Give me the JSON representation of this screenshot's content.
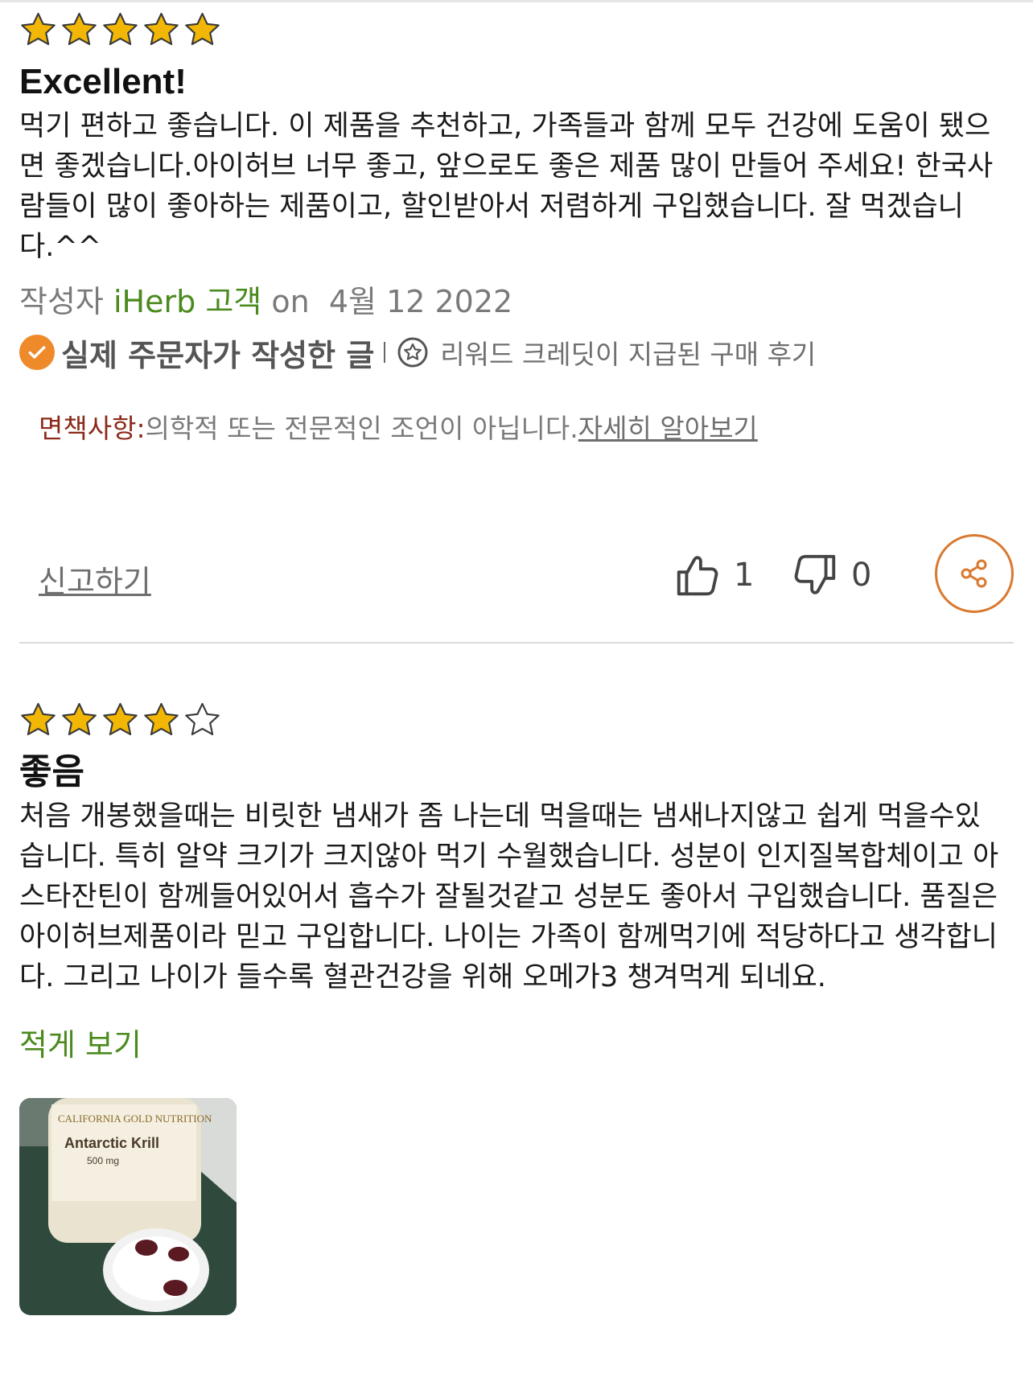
{
  "colors": {
    "star": "#f2b705",
    "accent_orange": "#ef8a2b",
    "author_green": "#4b8a1e",
    "disclaimer_label": "#8b2a1a"
  },
  "review1": {
    "rating": 5,
    "title": "Excellent!",
    "body": "먹기 편하고 좋습니다. 이 제품을 추천하고, 가족들과 함께 모두 건강에 도움이 됐으면 좋겠습니다.아이허브 너무 좋고, 앞으로도 좋은 제품 많이 만들어 주세요! 한국사람들이 많이 좋아하는 제품이고, 할인받아서 저렴하게 구입했습니다. 잘 먹겠습니다.^^",
    "by_label": "작성자",
    "author": "iHerb 고객",
    "on_label": "on",
    "date": "4월 12 2022",
    "verified": "실제 주문자가 작성한 글",
    "reward": "리워드 크레딧이 지급된 구매 후기",
    "disclaimer_label": "면책사항:",
    "disclaimer_text": "의학적 또는 전문적인 조언이 아닙니다.",
    "disclaimer_link": "자세히 알아보기",
    "report": "신고하기",
    "helpful_count": "1",
    "unhelpful_count": "0"
  },
  "review2": {
    "rating": 4,
    "title": "좋음",
    "body": "처음 개봉했을때는 비릿한 냄새가 좀 나는데 먹을때는 냄새나지않고 쉽게 먹을수있습니다. 특히 알약 크기가 크지않아 먹기 수월했습니다. 성분이 인지질복합체이고 아스타잔틴이 함께들어있어서 흡수가 잘될것같고 성분도 좋아서 구입했습니다. 품질은 아이허브제품이라 믿고 구입합니다. 나이는 가족이 함께먹기에 적당하다고 생각합니다. 그리고 나이가 들수록 혈관건강을 위해 오메가3 챙겨먹게 되네요.",
    "show_less": "적게 보기",
    "photo": {
      "brand": "CALIFORNIA GOLD NUTRITION",
      "product": "Antarctic Krill",
      "dose": "500 mg"
    }
  }
}
